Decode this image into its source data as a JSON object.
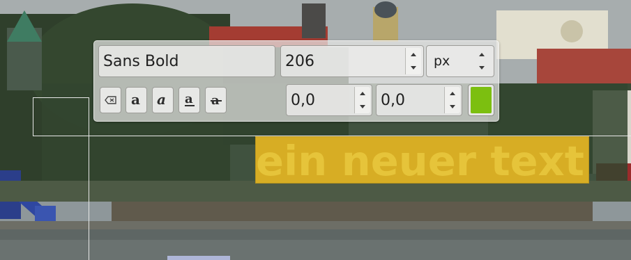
{
  "toolbar": {
    "font_name": "Sans Bold",
    "font_size": "206",
    "size_unit": "px",
    "baseline_offset": "0,0",
    "kerning_offset": "0,0",
    "text_color": "#7cbf10",
    "buttons": {
      "clear_style_icon": "clear-style-icon",
      "bold_icon": "bold-icon",
      "italic_icon": "italic-icon",
      "underline_icon": "underline-icon",
      "strikethrough_icon": "strikethrough-icon"
    }
  },
  "text_layer": {
    "content": "ein neuer text",
    "fill_color": "#d7ad24",
    "text_color": "#e6c43a"
  }
}
